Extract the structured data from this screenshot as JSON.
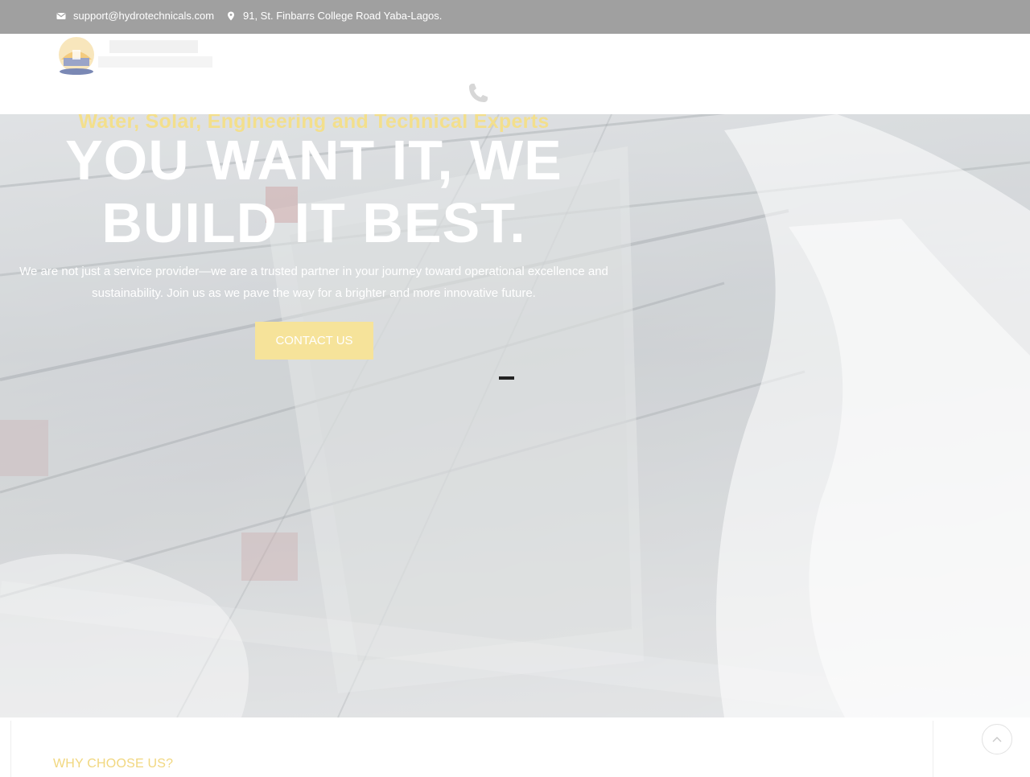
{
  "topbar": {
    "email": "support@hydrotechnicals.com",
    "address": "91, St. Finbarrs College Road Yaba-Lagos.",
    "email_icon": "envelope-icon",
    "address_icon": "map-marker-icon"
  },
  "nav": {
    "logo_icon": "company-logo",
    "phone_icon": "phone-icon"
  },
  "hero": {
    "subtitle": "Water, Solar, Engineering and Technical Experts",
    "headline_line1": "YOU WANT IT, WE",
    "headline_line2": "BUILD IT BEST.",
    "description_line1": "We are not just a service provider—we are a trusted partner in your journey toward operational excellence and",
    "description_line2": "sustainability. Join us as we pave the way for a brighter and more innovative future.",
    "cta_label": "CONTACT US"
  },
  "why": {
    "title": "WHY CHOOSE US?"
  },
  "scroll_top_icon": "chevron-up-icon",
  "colors": {
    "topbar": "#a0a0a0",
    "accent_yellow": "#f6e39a",
    "subtitle_yellow": "#f3df8c",
    "text_white": "#ffffff"
  }
}
